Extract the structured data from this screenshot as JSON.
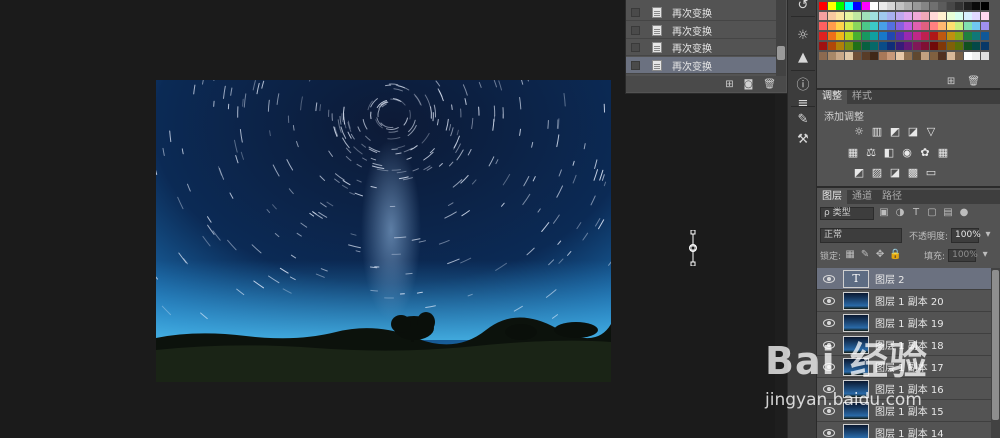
{
  "history": {
    "items": [
      "再次变换",
      "再次变换",
      "再次变换",
      "再次变换"
    ],
    "selected_index": 3
  },
  "adjustments": {
    "tabs": [
      "调整",
      "样式"
    ],
    "title": "添加调整"
  },
  "layers": {
    "tabs": [
      "图层",
      "通道",
      "路径"
    ],
    "filter_label": "ρ 类型",
    "blend_mode": "正常",
    "opacity_label": "不透明度:",
    "opacity_value": "100%",
    "lock_label": "锁定:",
    "fill_label": "填充:",
    "fill_value": "100%",
    "items": [
      {
        "name": "图层 2",
        "type": "text",
        "selected": true
      },
      {
        "name": "图层 1 副本 20",
        "type": "image",
        "selected": false
      },
      {
        "name": "图层 1 副本 19",
        "type": "image",
        "selected": false
      },
      {
        "name": "图层 1 副本 18",
        "type": "image",
        "selected": false
      },
      {
        "name": "图层 1 副本 17",
        "type": "image",
        "selected": false
      },
      {
        "name": "图层 1 副本 16",
        "type": "image",
        "selected": false
      },
      {
        "name": "图层 1 副本 15",
        "type": "image",
        "selected": false
      },
      {
        "name": "图层 1 副本 14",
        "type": "image",
        "selected": false
      }
    ]
  },
  "watermark": {
    "logo": "Bai 经验",
    "url": "jingyan.baidu.com"
  },
  "colors": {
    "panel_bg": "#535353",
    "selected_row": "#6b7180",
    "workspace_bg": "#1b1b1b"
  }
}
